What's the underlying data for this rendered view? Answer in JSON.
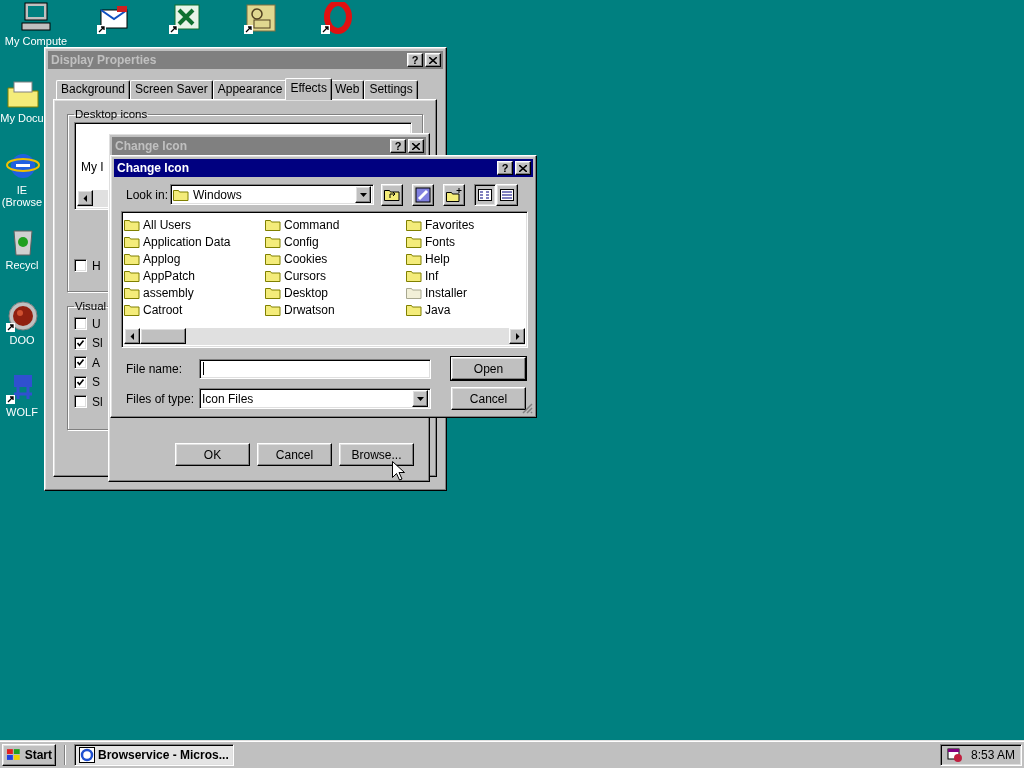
{
  "desktop": {
    "icons": [
      {
        "label": "My Compute",
        "shortcut": false
      },
      {
        "shortcut": true
      },
      {
        "shortcut": true
      },
      {
        "shortcut": true
      },
      {
        "shortcut": true
      },
      {
        "label": "My Docu",
        "shortcut": false
      },
      {
        "label": "IE (Browse",
        "shortcut": false
      },
      {
        "label": "Recycl",
        "shortcut": false
      },
      {
        "label": "DOO",
        "shortcut": true
      },
      {
        "label": "WOLF",
        "shortcut": true
      }
    ]
  },
  "display_properties": {
    "title": "Display Properties",
    "active": false,
    "help_button": "?",
    "tabs": [
      {
        "label": "Background",
        "selected": false
      },
      {
        "label": "Screen Saver",
        "selected": false
      },
      {
        "label": "Appearance",
        "selected": false
      },
      {
        "label": "Effects",
        "selected": true
      },
      {
        "label": "Web",
        "selected": false
      },
      {
        "label": "Settings",
        "selected": false
      }
    ],
    "desktop_icons_group": {
      "title": "Desktop icons",
      "list_item": "My I",
      "checkbox": {
        "label": "H",
        "checked": false
      }
    },
    "visual_group": {
      "title": "Visual",
      "options": [
        {
          "label": "U",
          "checked": false
        },
        {
          "label": "Sl",
          "checked": true
        },
        {
          "label": "A",
          "checked": true
        },
        {
          "label": "S",
          "checked": true
        },
        {
          "label": "Sl",
          "checked": false
        }
      ]
    }
  },
  "change_icon_back": {
    "title": "Change Icon",
    "active": false,
    "help_button": "?",
    "buttons": [
      "OK",
      "Cancel",
      "Browse..."
    ]
  },
  "change_icon": {
    "title": "Change Icon",
    "active": true,
    "help_button": "?",
    "look_in": {
      "label": "Look in:",
      "value": "Windows"
    },
    "files": [
      {
        "name": "All Users",
        "dimmed": false
      },
      {
        "name": "Application Data",
        "dimmed": false
      },
      {
        "name": "Applog",
        "dimmed": false
      },
      {
        "name": "AppPatch",
        "dimmed": false
      },
      {
        "name": "assembly",
        "dimmed": false
      },
      {
        "name": "Catroot",
        "dimmed": false
      },
      {
        "name": "Command",
        "dimmed": false
      },
      {
        "name": "Config",
        "dimmed": false
      },
      {
        "name": "Cookies",
        "dimmed": false
      },
      {
        "name": "Cursors",
        "dimmed": false
      },
      {
        "name": "Desktop",
        "dimmed": false
      },
      {
        "name": "Drwatson",
        "dimmed": false
      },
      {
        "name": "Favorites",
        "dimmed": false
      },
      {
        "name": "Fonts",
        "dimmed": false
      },
      {
        "name": "Help",
        "dimmed": false
      },
      {
        "name": "Inf",
        "dimmed": false
      },
      {
        "name": "Installer",
        "dimmed": true
      },
      {
        "name": "Java",
        "dimmed": false
      }
    ],
    "file_name": {
      "label": "File name:"
    },
    "files_of_type": {
      "label": "Files of type:",
      "value": "Icon Files"
    },
    "buttons": [
      "Open",
      "Cancel"
    ]
  },
  "taskbar": {
    "start": "Start",
    "tasks": [
      {
        "label": "Browservice - Micros...",
        "selected": true
      }
    ],
    "clock": "8:53 AM"
  }
}
